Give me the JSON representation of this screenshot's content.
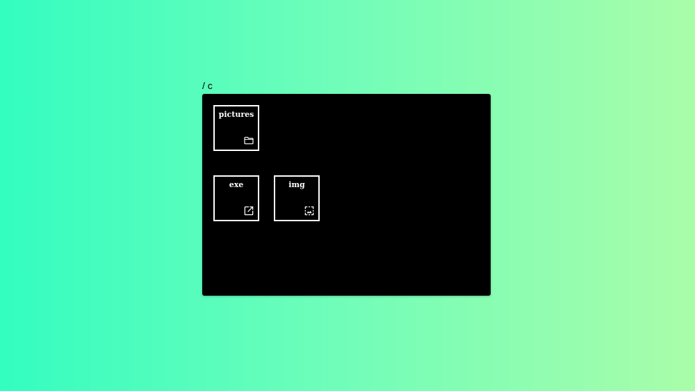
{
  "breadcrumb": {
    "path": "/ c"
  },
  "explorer": {
    "items": [
      {
        "label": "pictures",
        "type": "folder",
        "icon": "folder-icon"
      },
      {
        "label": "exe",
        "type": "executable",
        "icon": "open-in-new-icon"
      },
      {
        "label": "img",
        "type": "image",
        "icon": "image-icon"
      }
    ]
  },
  "colors": {
    "background_start": "#33fdc0",
    "background_end": "#a9fda9",
    "window": "#000000",
    "tile_border": "#ffffff",
    "text": "#ffffff"
  }
}
